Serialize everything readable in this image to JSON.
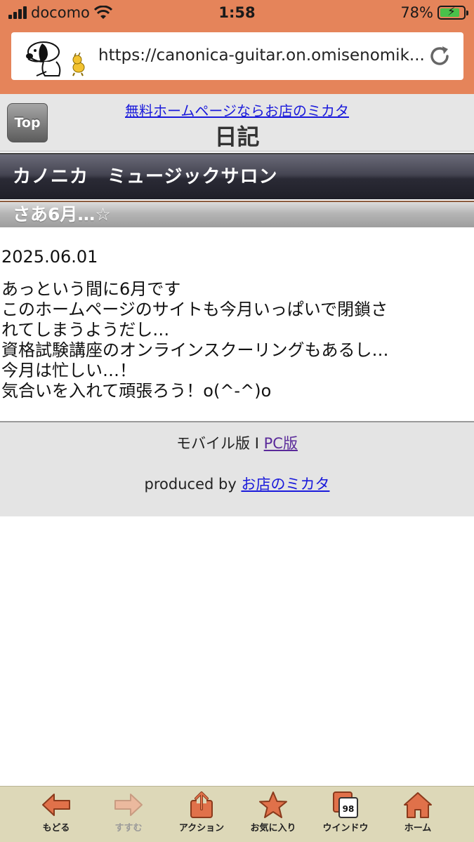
{
  "status_bar": {
    "carrier": "docomo",
    "time": "1:58",
    "battery_percent": "78%",
    "battery_level": 0.78,
    "battery_color": "#49c24a"
  },
  "browser": {
    "url": "https://canonica-guitar.on.omisenomik...",
    "chrome_color": "#e5845a"
  },
  "header": {
    "top_button": "Top",
    "promo_link": "無料ホームページならお店のミカタ",
    "title": "日記"
  },
  "site": {
    "name": "カノニカ　ミュージックサロン"
  },
  "entry": {
    "title": "さあ6月…☆",
    "date": "2025.06.01",
    "lines": [
      "あっという間に6月です",
      "このホームページのサイトも今月いっぱいで閉鎖さ",
      "れてしまうようだし…",
      "資格試験講座のオンラインスクーリングもあるし…",
      "今月は忙しい…！",
      "気合いを入れて頑張ろう！o(^-^)o"
    ]
  },
  "footer": {
    "mobile_label": "モバイル版",
    "separator": "I",
    "pc_link": "PC版",
    "produced_by": "produced by",
    "producer_link": "お店のミカタ"
  },
  "toolbar": {
    "back": "もどる",
    "forward": "すすむ",
    "action": "アクション",
    "favorites": "お気に入り",
    "windows": "ウインドウ",
    "window_count": "98",
    "home": "ホーム",
    "icon_color": "#e0714a"
  }
}
